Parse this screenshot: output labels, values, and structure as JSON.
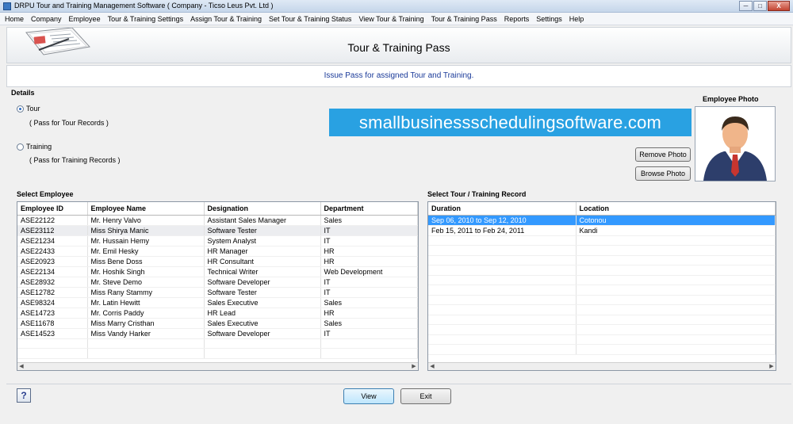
{
  "window": {
    "title": "DRPU Tour and Training Management Software ( Company - Ticso Leus Pvt. Ltd )",
    "minimize_icon": "minimize-icon",
    "maximize_icon": "maximize-icon",
    "close_label": "X"
  },
  "menu": {
    "items": [
      {
        "label": "Home"
      },
      {
        "label": "Company"
      },
      {
        "label": "Employee"
      },
      {
        "label": "Tour & Training Settings"
      },
      {
        "label": "Assign Tour & Training"
      },
      {
        "label": "Set Tour & Training Status"
      },
      {
        "label": "View Tour & Training"
      },
      {
        "label": "Tour & Training Pass"
      },
      {
        "label": "Reports"
      },
      {
        "label": "Settings"
      },
      {
        "label": "Help"
      }
    ]
  },
  "banner": {
    "heading": "Tour & Training Pass",
    "subheading": "Issue Pass for assigned Tour and Training.",
    "icon": "document-pen-icon"
  },
  "details": {
    "label": "Details",
    "tour": {
      "label": "Tour",
      "hint": "( Pass for Tour Records )",
      "selected": true
    },
    "training": {
      "label": "Training",
      "hint": "( Pass for Training Records )",
      "selected": false
    }
  },
  "watermark": "smallbusinessschedulingsoftware.com",
  "photo": {
    "label": "Employee Photo",
    "remove_label": "Remove Photo",
    "browse_label": "Browse Photo",
    "icon": "employee-avatar-icon"
  },
  "employees": {
    "label": "Select Employee",
    "columns": [
      "Employee ID",
      "Employee Name",
      "Designation",
      "Department"
    ],
    "rows": [
      [
        "ASE22122",
        "Mr. Henry Valvo",
        "Assistant Sales Manager",
        "Sales"
      ],
      [
        "ASE23112",
        "Miss Shirya Manic",
        "Software Tester",
        "IT"
      ],
      [
        "ASE21234",
        "Mr. Hussain Hemy",
        "System Analyst",
        "IT"
      ],
      [
        "ASE22433",
        "Mr. Emil Hesky",
        "HR Manager",
        "HR"
      ],
      [
        "ASE20923",
        "Miss Bene Doss",
        "HR Consultant",
        "HR"
      ],
      [
        "ASE22134",
        "Mr. Hoshik Singh",
        "Technical Writer",
        "Web Development"
      ],
      [
        "ASE28932",
        "Mr. Steve Demo",
        "Software Developer",
        "IT"
      ],
      [
        "ASE12782",
        "Miss Rany Stammy",
        "Software Tester",
        "IT"
      ],
      [
        "ASE98324",
        "Mr. Latin Hewitt",
        "Sales Executive",
        "Sales"
      ],
      [
        "ASE14723",
        "Mr. Corris Paddy",
        "HR Lead",
        "HR"
      ],
      [
        "ASE11678",
        "Miss Marry Cristhan",
        "Sales Executive",
        "Sales"
      ],
      [
        "ASE14523",
        "Miss Vandy Harker",
        "Software Developer",
        "IT"
      ]
    ]
  },
  "records": {
    "label": "Select Tour / Training Record",
    "columns": [
      "Duration",
      "Location"
    ],
    "rows": [
      [
        "Sep 06, 2010 to Sep 12, 2010",
        "Cotonou"
      ],
      [
        "Feb 15, 2011 to Feb 24, 2011",
        "Kandi"
      ]
    ]
  },
  "footer": {
    "view_label": "View",
    "exit_label": "Exit",
    "help_label": "?"
  },
  "colors": {
    "accent": "#3399ff",
    "watermark_bg": "#29a1e2",
    "subheading": "#1a3a99"
  }
}
